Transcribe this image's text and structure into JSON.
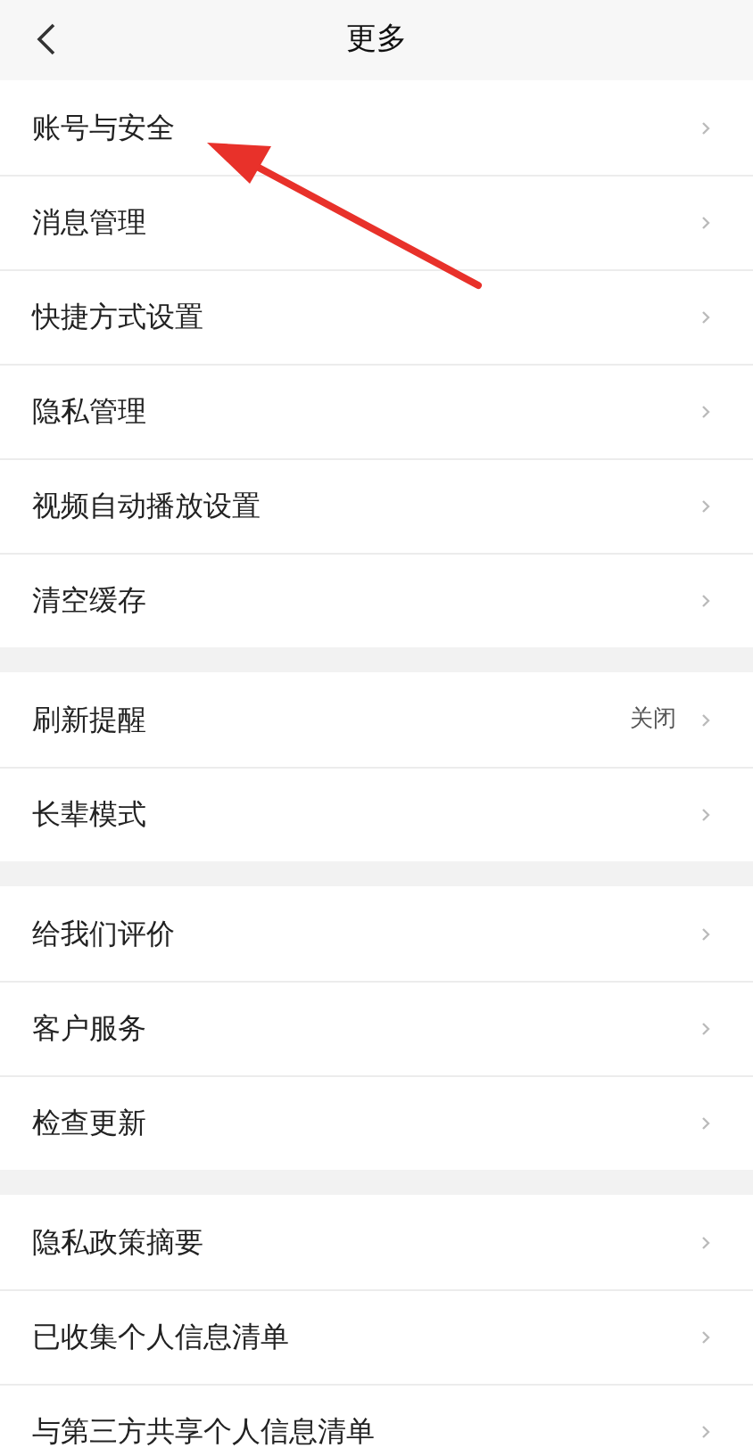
{
  "header": {
    "title": "更多"
  },
  "groups": [
    {
      "items": [
        {
          "label": "账号与安全"
        },
        {
          "label": "消息管理"
        },
        {
          "label": "快捷方式设置"
        },
        {
          "label": "隐私管理"
        },
        {
          "label": "视频自动播放设置"
        },
        {
          "label": "清空缓存"
        }
      ]
    },
    {
      "items": [
        {
          "label": "刷新提醒",
          "value": "关闭"
        },
        {
          "label": "长辈模式"
        }
      ]
    },
    {
      "items": [
        {
          "label": "给我们评价"
        },
        {
          "label": "客户服务"
        },
        {
          "label": "检查更新"
        }
      ]
    },
    {
      "items": [
        {
          "label": "隐私政策摘要"
        },
        {
          "label": "已收集个人信息清单"
        },
        {
          "label": "与第三方共享个人信息清单"
        }
      ]
    }
  ]
}
